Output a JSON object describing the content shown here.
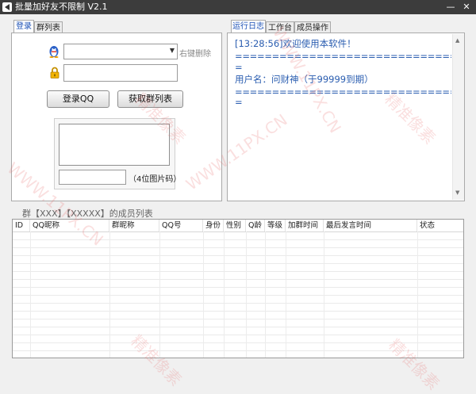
{
  "window": {
    "title": "批量加好友不限制 V2.1",
    "minimize": "—",
    "close": "✕"
  },
  "left_tabs": [
    {
      "label": "登录"
    },
    {
      "label": "群列表"
    }
  ],
  "login": {
    "qq_input_value": "",
    "right_key_delete": "右键删除",
    "password_value": "",
    "login_button": "登录QQ",
    "get_groups_button": "获取群列表",
    "captcha_value": "",
    "captcha_hint": "（4位图片码）",
    "qq_icon": "penguin-icon",
    "lock_icon": "lock-icon"
  },
  "right_tabs": [
    {
      "label": "运行日志"
    },
    {
      "label": "工作台"
    },
    {
      "label": "成员操作"
    }
  ],
  "log": {
    "lines": [
      "[13:28:56]欢迎使用本软件！",
      "================================",
      "=",
      "用户名：问财神（于99999到期）",
      "================================",
      "="
    ]
  },
  "member_list_title": "群【XXX】【XXXXX】的成员列表",
  "table": {
    "columns": [
      "ID",
      "QQ昵称",
      "群昵称",
      "QQ号",
      "身份",
      "性别",
      "Q龄",
      "等级",
      "加群时间",
      "最后发言时间",
      "状态"
    ],
    "rows": []
  },
  "watermark": {
    "text1": "精准像素",
    "text2": "WWW.11PX.CN",
    "color": "#e66e6e"
  },
  "colors": {
    "titlebar": "#3c3c3c",
    "accent": "#1a4fb5",
    "log_text": "#2a5db0"
  }
}
